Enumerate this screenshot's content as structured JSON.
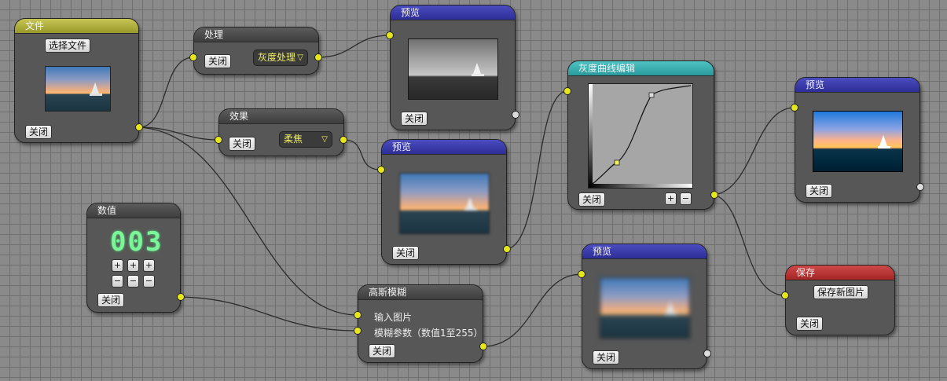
{
  "nodes": {
    "file": {
      "title": "文件",
      "choose_label": "选择文件",
      "close_label": "关闭"
    },
    "process": {
      "title": "处理",
      "close_label": "关闭",
      "select_value": "灰度处理"
    },
    "effect": {
      "title": "效果",
      "close_label": "关闭",
      "select_value": "柔焦"
    },
    "preview1": {
      "title": "预览",
      "close_label": "关闭"
    },
    "preview2": {
      "title": "预览",
      "close_label": "关闭"
    },
    "curve": {
      "title": "灰度曲线编辑",
      "close_label": "关闭",
      "plus_label": "+",
      "minus_label": "−"
    },
    "preview3": {
      "title": "预览",
      "close_label": "关闭"
    },
    "value": {
      "title": "数值",
      "display": "003",
      "plus_label": "+",
      "minus_label": "−",
      "close_label": "关闭"
    },
    "gauss": {
      "title": "高斯模糊",
      "input1_label": "输入图片",
      "input2_label": "模糊参数（数值1至255）",
      "close_label": "关闭"
    },
    "preview4": {
      "title": "预览",
      "close_label": "关闭"
    },
    "save": {
      "title": "保存",
      "save_label": "保存新图片",
      "close_label": "关闭"
    }
  },
  "colors": {
    "port": "#e6e61c",
    "file_header": "#b5b43d",
    "preview_header": "#3a3ba8",
    "curve_header": "#3fb1b3",
    "save_header": "#b83434",
    "digits": "#7cf49a"
  }
}
